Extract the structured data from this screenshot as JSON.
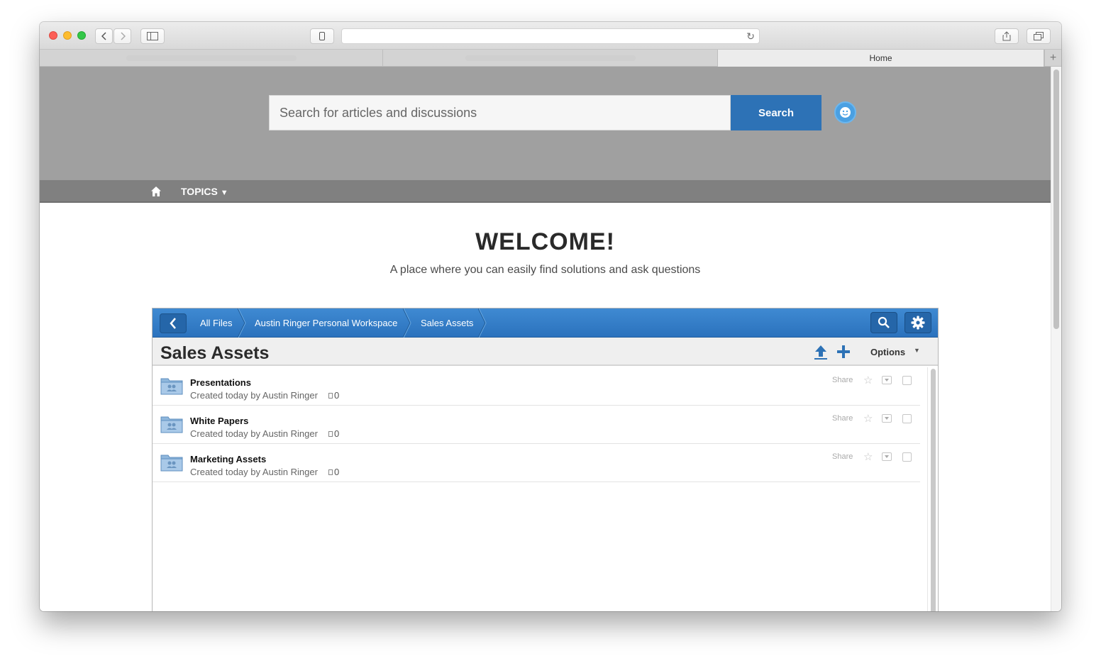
{
  "browser": {
    "tabs": [
      {
        "label": ""
      },
      {
        "label": ""
      },
      {
        "label": "Home"
      }
    ],
    "new_tab_label": "+"
  },
  "hero": {
    "search_placeholder": "Search for articles and discussions",
    "search_button": "Search"
  },
  "nav": {
    "topics_label": "TOPICS"
  },
  "welcome": {
    "title": "WELCOME!",
    "tagline": "A place where you can easily find solutions and ask questions"
  },
  "files": {
    "breadcrumbs": [
      {
        "label": "All Files"
      },
      {
        "label": "Austin Ringer Personal Workspace"
      },
      {
        "label": "Sales Assets"
      }
    ],
    "title": "Sales Assets",
    "options_label": "Options",
    "items": [
      {
        "name": "Presentations",
        "meta": "Created today by Austin Ringer",
        "count": "0",
        "share": "Share"
      },
      {
        "name": "White Papers",
        "meta": "Created today by Austin Ringer",
        "count": "0",
        "share": "Share"
      },
      {
        "name": "Marketing Assets",
        "meta": "Created today by Austin Ringer",
        "count": "0",
        "share": "Share"
      }
    ]
  },
  "colors": {
    "brand_blue": "#2d72b6",
    "hero_gray": "#a0a0a0",
    "nav_gray": "#808080"
  }
}
